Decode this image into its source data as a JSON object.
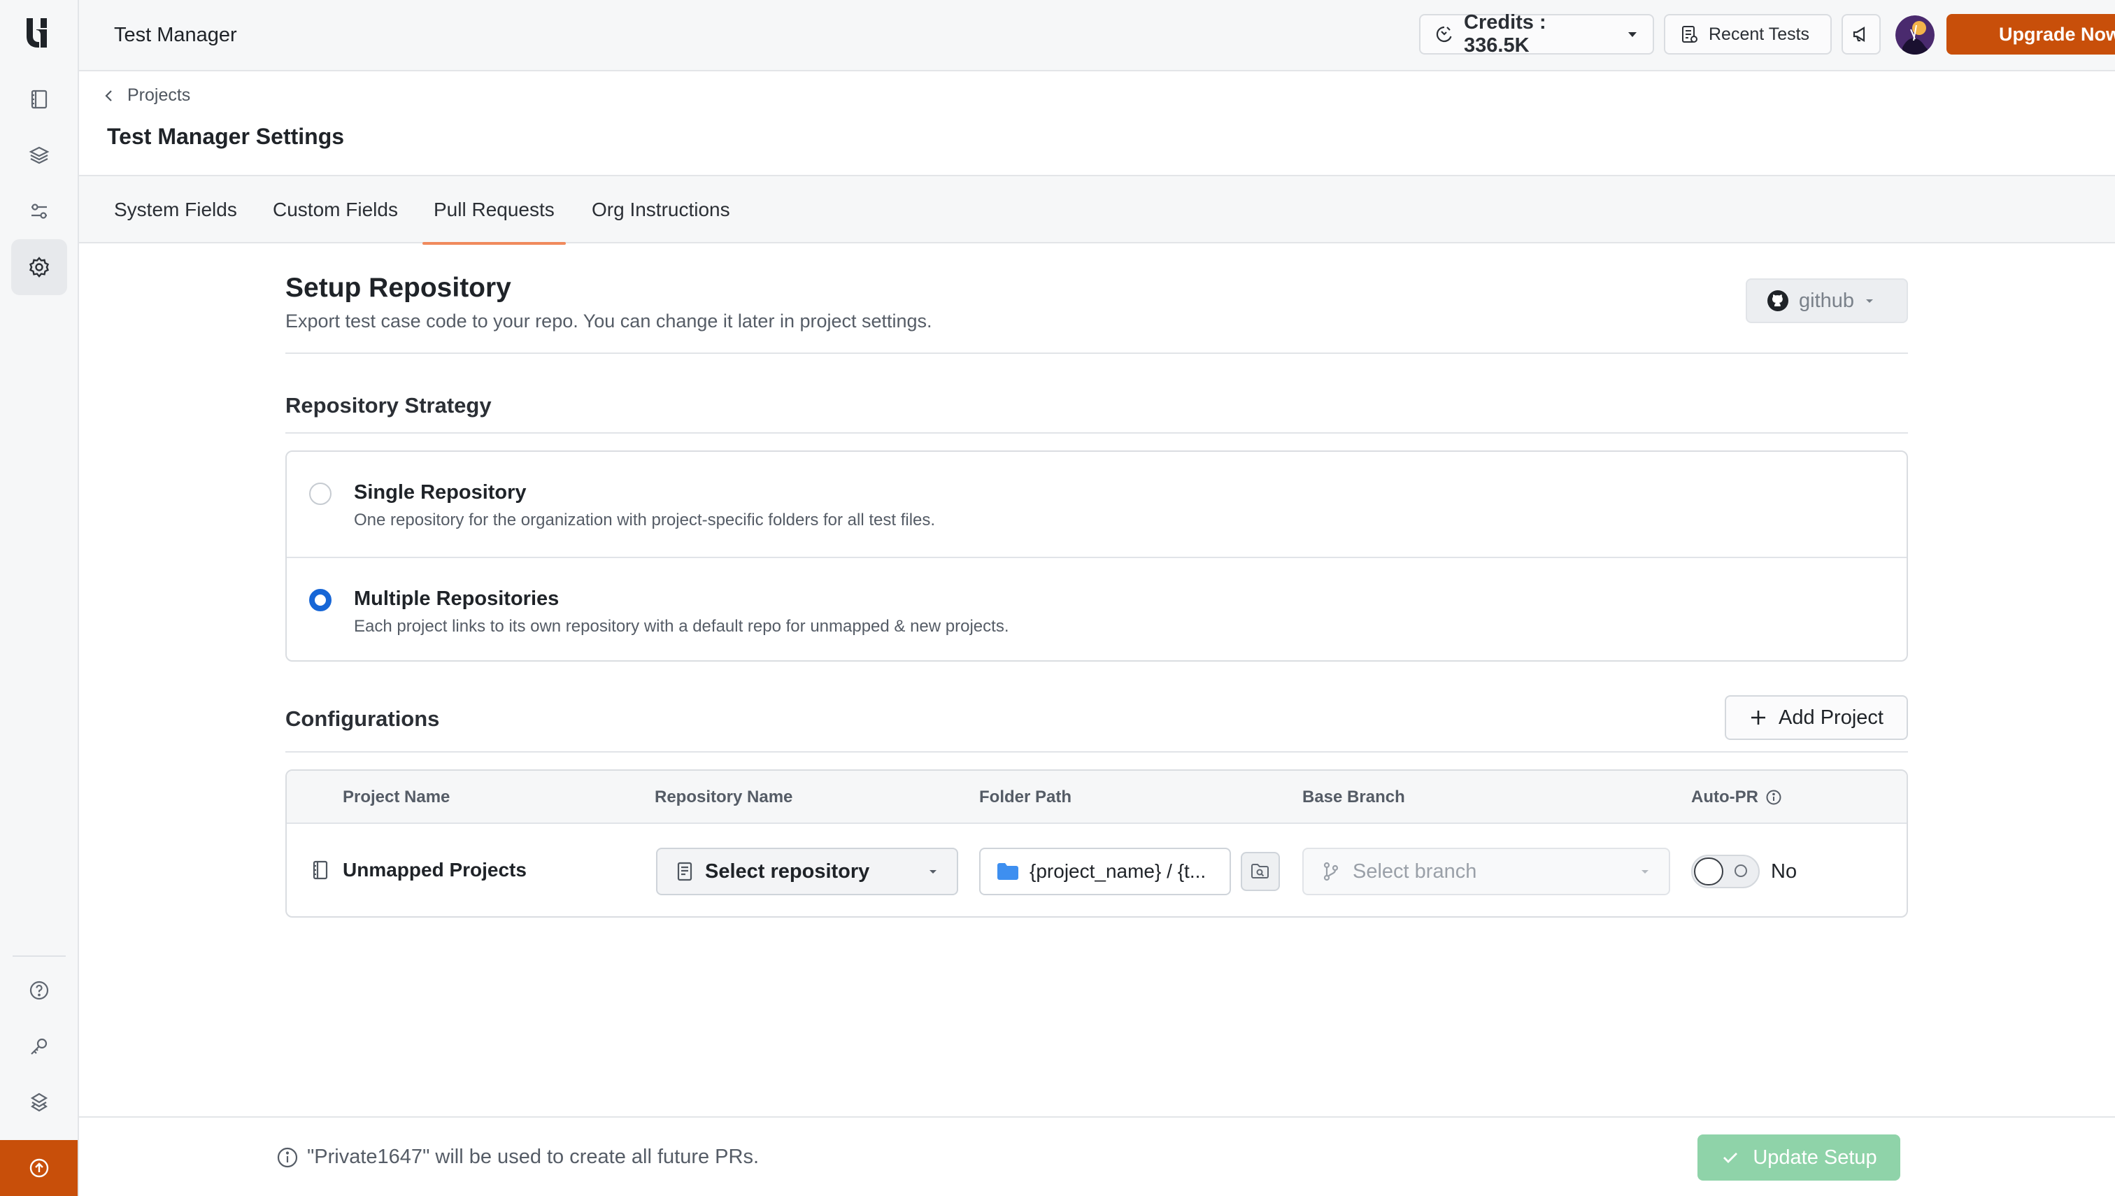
{
  "topbar": {
    "app_title": "Test Manager",
    "credits_label": "Credits : 336.5K",
    "recent_tests_label": "Recent Tests",
    "upgrade_label": "Upgrade Now"
  },
  "breadcrumb": {
    "parent": "Projects"
  },
  "page": {
    "title": "Test Manager Settings"
  },
  "tabs": [
    {
      "label": "System Fields"
    },
    {
      "label": "Custom Fields"
    },
    {
      "label": "Pull Requests",
      "active": true
    },
    {
      "label": "Org Instructions"
    }
  ],
  "setup": {
    "title": "Setup Repository",
    "subtitle": "Export test case code to your repo. You can change it later in project settings.",
    "provider": "github"
  },
  "strategy": {
    "title": "Repository Strategy",
    "options": [
      {
        "title": "Single Repository",
        "description": "One repository for the organization with project-specific folders for all test files.",
        "selected": false
      },
      {
        "title": "Multiple Repositories",
        "description": "Each project links to its own repository with a default repo for unmapped & new projects.",
        "selected": true
      }
    ]
  },
  "configurations": {
    "title": "Configurations",
    "add_project_label": "Add Project",
    "columns": [
      "Project Name",
      "Repository Name",
      "Folder Path",
      "Base Branch",
      "Auto-PR"
    ],
    "rows": [
      {
        "project": "Unmapped Projects",
        "repository_placeholder": "Select repository",
        "folder_path": "{project_name} / {t...",
        "branch_placeholder": "Select branch",
        "auto_pr": "No"
      }
    ]
  },
  "footer": {
    "note": "\"Private1647\" will be used to create all future PRs.",
    "update_label": "Update Setup"
  },
  "colors": {
    "accent": "#c84f0a",
    "radio_selected": "#1766d6",
    "tab_underline": "#f08a5d",
    "update_button_disabled": "#8fd3a9"
  }
}
